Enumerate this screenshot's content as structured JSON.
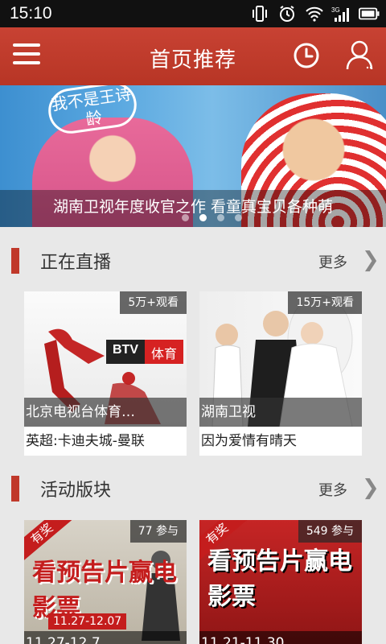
{
  "status_bar": {
    "time": "15:10",
    "icons": [
      "vibrate-icon",
      "alarm-icon",
      "wifi-icon",
      "signal-3g-icon",
      "battery-icon"
    ]
  },
  "app_bar": {
    "title": "首页推荐",
    "menu_icon": "hamburger-icon",
    "history_icon": "clock-icon",
    "user_icon": "user-icon",
    "color": "#c0392b"
  },
  "banner": {
    "caption": "湖南卫视年度收官之作 看童真宝贝各种萌",
    "sticker_text": "我不是王诗龄",
    "page_count": 4,
    "active_index": 1
  },
  "sections": [
    {
      "title": "正在直播",
      "more_label": "更多",
      "cards": [
        {
          "badge": "5万+观看",
          "overlay": "北京电视台体育…",
          "subtitle": "英超:卡迪夫城-曼联",
          "logo_a": "BTV",
          "logo_b": "体育"
        },
        {
          "badge": "15万+观看",
          "overlay": "湖南卫视",
          "subtitle": "因为爱情有晴天"
        }
      ]
    },
    {
      "title": "活动版块",
      "more_label": "更多",
      "cards": [
        {
          "badge": "77 参与",
          "corner": "有奖",
          "headline": "看预告片赢电影票",
          "date_tag": "11.27-12.07",
          "overlay": "11.27-12.7"
        },
        {
          "badge": "549 参与",
          "corner": "有奖",
          "headline": "看预告片赢电影票",
          "overlay": "11.21-11.30"
        }
      ]
    }
  ]
}
